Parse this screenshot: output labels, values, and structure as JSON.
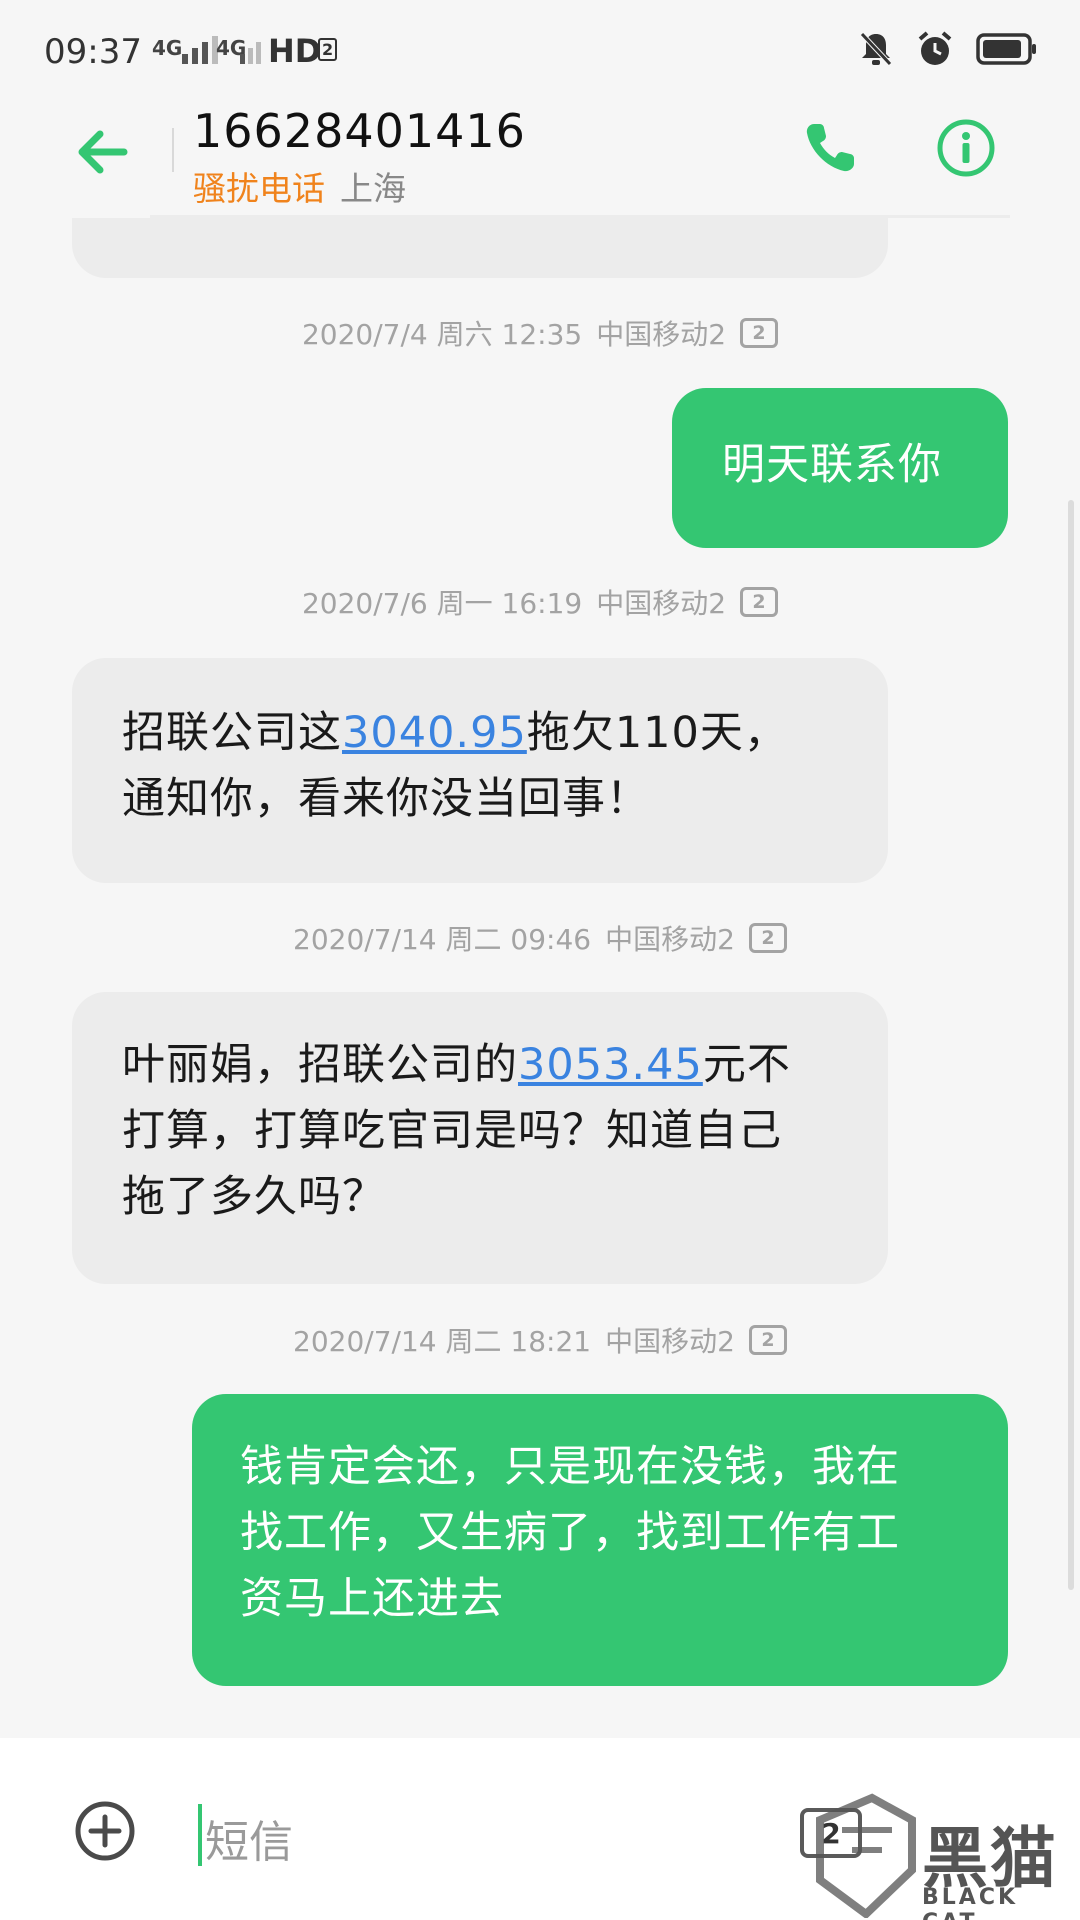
{
  "status_bar": {
    "time": "09:37",
    "network_1": "4G",
    "network_2": "4G",
    "hd_label": "HD",
    "hd_sim": "2",
    "battery_level": 0.9
  },
  "header": {
    "contact_number": "16628401416",
    "spam_tag": "骚扰电话",
    "location": "上海"
  },
  "messages": [
    {
      "timestamp": "2020/7/4 周六 12:35",
      "carrier": "中国移动2",
      "sim": "2",
      "direction": "outgoing",
      "text": "明天联系你"
    },
    {
      "timestamp": "2020/7/6 周一 16:19",
      "carrier": "中国移动2",
      "sim": "2",
      "direction": "incoming",
      "line1_pre": "招联公司这",
      "line1_link": "3040.95",
      "line1_post": "拖欠110天，",
      "line2": "通知你，看来你没当回事！"
    },
    {
      "timestamp": "2020/7/14 周二 09:46",
      "carrier": "中国移动2",
      "sim": "2",
      "direction": "incoming",
      "line1_pre": "叶丽娟，招联公司的",
      "line1_link": "3053.45",
      "line1_post": "元不",
      "line2": "打算，打算吃官司是吗？知道自己",
      "line3": "拖了多久吗？"
    },
    {
      "timestamp": "2020/7/14 周二 18:21",
      "carrier": "中国移动2",
      "sim": "2",
      "direction": "outgoing",
      "line1": "钱肯定会还，只是现在没钱，我在",
      "line2": "找工作，又生病了，找到工作有工",
      "line3": "资马上还进去"
    }
  ],
  "composer": {
    "placeholder": "短信",
    "sim_select": "2"
  },
  "watermark": {
    "text": "黑猫",
    "sub": "BLACK CAT"
  }
}
